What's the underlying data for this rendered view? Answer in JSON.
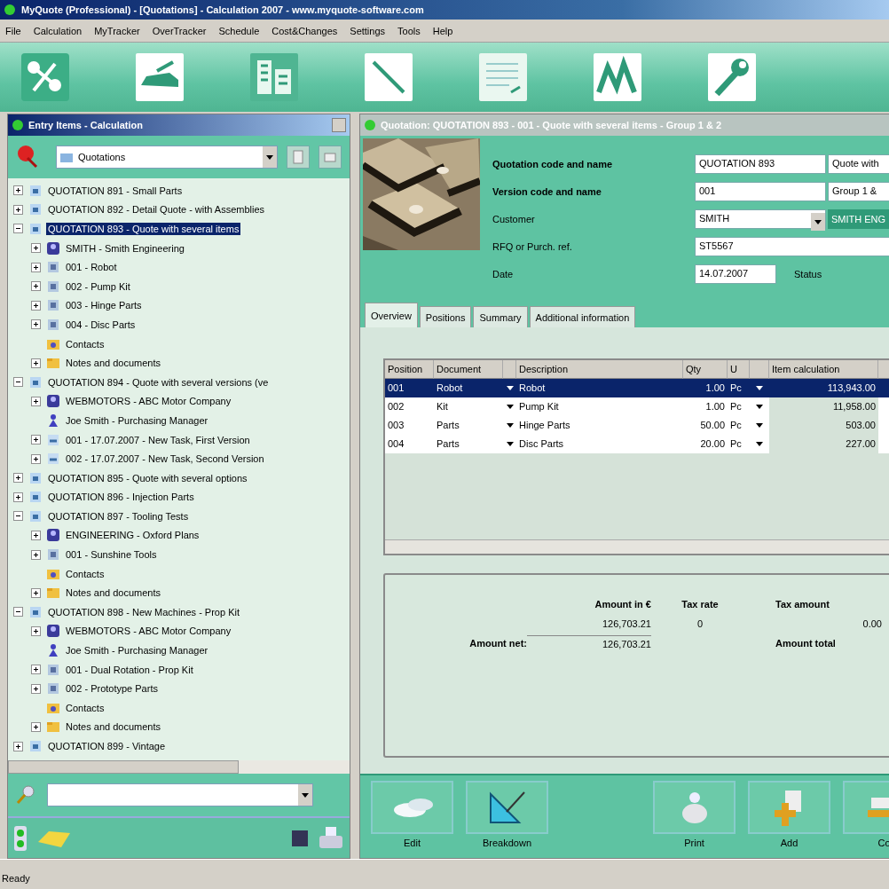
{
  "window": {
    "title": "MyQuote (Professional) - [Quotations] - Calculation 2007 - www.myquote-software.com"
  },
  "menu": [
    "File",
    "Calculation",
    "MyTracker",
    "OverTracker",
    "Schedule",
    "Cost&Changes",
    "Settings",
    "Tools",
    "Help"
  ],
  "left_panel": {
    "title": "Entry Items - Calculation",
    "filter": "Quotations",
    "tree": [
      {
        "label": "QUOTATION 891 - Small Parts",
        "kind": "quote",
        "expanded": false,
        "selected": false
      },
      {
        "label": "QUOTATION 892 - Detail Quote - with Assemblies",
        "kind": "quote",
        "expanded": false,
        "selected": false
      },
      {
        "label": "QUOTATION 893 - Quote with several items",
        "kind": "quote",
        "expanded": true,
        "selected": true,
        "children": [
          {
            "label": "SMITH - Smith Engineering",
            "kind": "customer",
            "expanded": false,
            "selected": false
          },
          {
            "label": "001 - Robot",
            "kind": "position",
            "expanded": false,
            "selected": false
          },
          {
            "label": "002 - Pump Kit",
            "kind": "position",
            "expanded": false,
            "selected": false
          },
          {
            "label": "003 - Hinge Parts",
            "kind": "position",
            "expanded": false,
            "selected": false
          },
          {
            "label": "004 - Disc Parts",
            "kind": "position",
            "expanded": false,
            "selected": false
          },
          {
            "label": "Contacts",
            "kind": "contacts",
            "selected": false
          },
          {
            "label": "Notes and documents",
            "kind": "notes",
            "expanded": false,
            "selected": false
          }
        ]
      },
      {
        "label": "QUOTATION 894 - Quote with several versions (ve",
        "kind": "quote",
        "expanded": true,
        "selected": false,
        "children": [
          {
            "label": "WEBMOTORS - ABC Motor Company",
            "kind": "customer",
            "expanded": false,
            "selected": false
          },
          {
            "label": "Joe Smith - Purchasing Manager",
            "kind": "person",
            "selected": false
          },
          {
            "label": "001 - 17.07.2007 - New Task, First Version",
            "kind": "task",
            "expanded": false,
            "selected": false
          },
          {
            "label": "002 - 17.07.2007 - New Task, Second Version",
            "kind": "task",
            "expanded": false,
            "selected": false
          }
        ]
      },
      {
        "label": "QUOTATION 895 - Quote with several options",
        "kind": "quote",
        "expanded": false,
        "selected": false
      },
      {
        "label": "QUOTATION 896 - Injection Parts",
        "kind": "quote",
        "expanded": false,
        "selected": false
      },
      {
        "label": "QUOTATION 897 - Tooling Tests",
        "kind": "quote",
        "expanded": true,
        "selected": false,
        "children": [
          {
            "label": "ENGINEERING - Oxford Plans",
            "kind": "customer",
            "expanded": false,
            "selected": false
          },
          {
            "label": "001 - Sunshine Tools",
            "kind": "position",
            "expanded": false,
            "selected": false
          },
          {
            "label": "Contacts",
            "kind": "contacts",
            "selected": false
          },
          {
            "label": "Notes and documents",
            "kind": "notes",
            "expanded": false,
            "selected": false
          }
        ]
      },
      {
        "label": "QUOTATION 898 - New Machines - Prop Kit",
        "kind": "quote",
        "expanded": true,
        "selected": false,
        "children": [
          {
            "label": "WEBMOTORS - ABC Motor Company",
            "kind": "customer",
            "expanded": false,
            "selected": false
          },
          {
            "label": "Joe Smith - Purchasing Manager",
            "kind": "person",
            "selected": false
          },
          {
            "label": "001 - Dual Rotation - Prop Kit",
            "kind": "position",
            "expanded": false,
            "selected": false
          },
          {
            "label": "002 - Prototype Parts",
            "kind": "position",
            "expanded": false,
            "selected": false
          },
          {
            "label": "Contacts",
            "kind": "contacts",
            "selected": false
          },
          {
            "label": "Notes and documents",
            "kind": "notes",
            "expanded": false,
            "selected": false
          }
        ]
      },
      {
        "label": "QUOTATION 899 - Vintage",
        "kind": "quote",
        "expanded": false,
        "selected": false
      }
    ]
  },
  "right_panel": {
    "title": "Quotation: QUOTATION 893 - 001 - Quote with several items - Group 1 & 2",
    "form": [
      {
        "label": "Quotation code and name",
        "bold": true,
        "kind": "pair",
        "value": "QUOTATION 893",
        "value_2": "Quote with"
      },
      {
        "label": "Version code and name",
        "bold": true,
        "kind": "pair",
        "value": "001",
        "value_2": "Group 1 &"
      },
      {
        "label": "Customer",
        "bold": false,
        "kind": "dropdown",
        "value": "SMITH",
        "button": "SMITH ENG"
      },
      {
        "label": "RFQ or Purch. ref.",
        "bold": false,
        "kind": "wide",
        "value": "ST5567"
      },
      {
        "label": "Date",
        "bold": false,
        "kind": "date",
        "value": "14.07.2007",
        "extra_label": "Status"
      }
    ],
    "tabs": [
      {
        "label": "Overview",
        "selected": true
      },
      {
        "label": "Positions",
        "selected": false
      },
      {
        "label": "Summary",
        "selected": false
      },
      {
        "label": "Additional information",
        "selected": false
      }
    ],
    "table": {
      "columns": [
        "Position",
        "Document",
        "Description",
        "Qty",
        "U",
        "Item calculation"
      ],
      "rows": [
        {
          "selected": true,
          "cells": [
            "001",
            "Robot",
            "Robot",
            "1.00",
            "Pc",
            "113,943.00"
          ]
        },
        {
          "selected": false,
          "cells": [
            "002",
            "Kit",
            "Pump Kit",
            "1.00",
            "Pc",
            "11,958.00"
          ]
        },
        {
          "selected": false,
          "cells": [
            "003",
            "Parts",
            "Hinge Parts",
            "50.00",
            "Pc",
            "503.00"
          ]
        },
        {
          "selected": false,
          "cells": [
            "004",
            "Parts",
            "Disc Parts",
            "20.00",
            "Pc",
            "227.00"
          ]
        }
      ]
    },
    "totals": {
      "amount_heading": "Amount in €",
      "amount": "126,703.21",
      "net_label": "Amount net:",
      "net": "126,703.21",
      "tax_rate_heading": "Tax rate",
      "tax_rate": "0",
      "tax_amount_heading": "Tax amount",
      "tax_amount": "0.00",
      "total_label": "Amount total"
    },
    "buttons": [
      "Edit",
      "Breakdown",
      "Print",
      "Add",
      "Co"
    ]
  },
  "status_bar": "Ready"
}
